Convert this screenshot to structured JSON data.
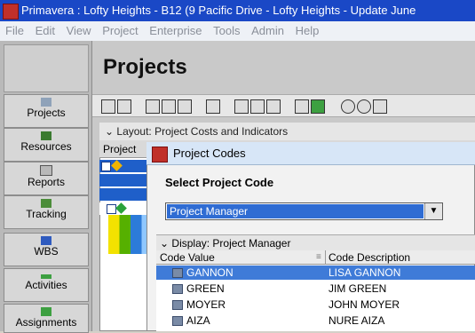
{
  "window": {
    "title": "Primavera : Lofty Heights - B12 (9 Pacific Drive - Lofty Heights - Update June"
  },
  "menu": [
    "File",
    "Edit",
    "View",
    "Project",
    "Enterprise",
    "Tools",
    "Admin",
    "Help"
  ],
  "nav": {
    "items": [
      {
        "label": "Projects",
        "icon": "projects-icon"
      },
      {
        "label": "Resources",
        "icon": "resources-icon"
      },
      {
        "label": "Reports",
        "icon": "reports-icon"
      },
      {
        "label": "Tracking",
        "icon": "tracking-icon"
      },
      {
        "label": "WBS",
        "icon": "wbs-icon"
      },
      {
        "label": "Activities",
        "icon": "activities-icon"
      },
      {
        "label": "Assignments",
        "icon": "assignments-icon"
      }
    ]
  },
  "main": {
    "page_title": "Projects",
    "layout_label": "Layout: Project Costs and Indicators",
    "project_header": "Project"
  },
  "dialog": {
    "title": "Project Codes",
    "select_label": "Select Project Code",
    "selected_value": "Project Manager",
    "display_label": "Display: Project Manager",
    "columns": [
      "Code Value",
      "Code Description"
    ],
    "rows": [
      {
        "value": "GANNON",
        "description": "LISA GANNON",
        "selected": true
      },
      {
        "value": "GREEN",
        "description": "JIM GREEN",
        "selected": false
      },
      {
        "value": "MOYER",
        "description": "JOHN MOYER",
        "selected": false
      },
      {
        "value": "AIZA",
        "description": "NURE AIZA",
        "selected": false
      }
    ]
  },
  "colors": {
    "titlebar": "#1a48c6",
    "selection": "#3f7bd8"
  }
}
